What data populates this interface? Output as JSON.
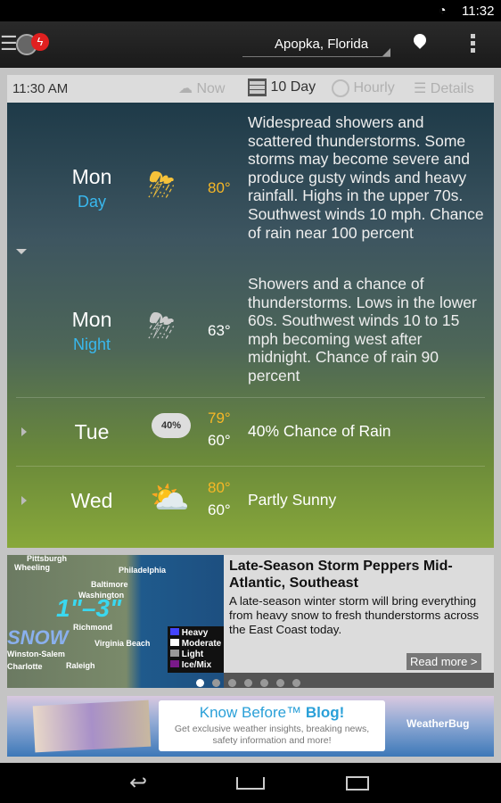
{
  "status": {
    "time": "11:32"
  },
  "actionbar": {
    "location": "Apopka, Florida"
  },
  "tabs": {
    "time": "11:30 AM",
    "now": "Now",
    "ten_day": "10 Day",
    "hourly": "Hourly",
    "details": "Details"
  },
  "forecast": [
    {
      "day": "Mon",
      "period": "Day",
      "temp": "80°",
      "icon": "sun-thunderstorm-icon",
      "desc": "Widespread showers and scattered thunderstorms. Some storms may become severe and produce gusty winds and heavy rainfall. Highs in the upper 70s. Southwest winds 10 mph. Chance of rain near 100 percent"
    },
    {
      "day": "Mon",
      "period": "Night",
      "temp": "63°",
      "icon": "thunderstorm-icon",
      "desc": "Showers and a chance of thunderstorms. Lows in the lower 60s. Southwest winds 10 to 15 mph becoming west after midnight. Chance of rain 90 percent"
    },
    {
      "day": "Tue",
      "high": "79°",
      "low": "60°",
      "icon": "rain-40-icon",
      "badge": "40%",
      "desc": "40% Chance of Rain"
    },
    {
      "day": "Wed",
      "high": "80°",
      "low": "60°",
      "icon": "partly-sunny-icon",
      "desc": "Partly Sunny"
    }
  ],
  "news": {
    "title": "Late-Season Storm Peppers Mid-Atlantic, Southeast",
    "body": "A late-season winter storm will bring everything from heavy snow to fresh thunderstorms across the East Coast today.",
    "read_more": "Read more >",
    "map_label": "1\"–3\"",
    "map_snow": "SNOW",
    "cities": [
      "Pittsburgh",
      "Wheeling",
      "Philadelphia",
      "Baltimore",
      "Washington",
      "Richmond",
      "Virginia Beach",
      "Winston-Salem",
      "Raleigh",
      "Charlotte"
    ],
    "legend": [
      "Heavy",
      "Moderate",
      "Light",
      "Ice/Mix"
    ],
    "page_dots": 7,
    "active_dot": 0
  },
  "ad": {
    "title_a": "Know Before™",
    "title_b": "Blog!",
    "text": "Get exclusive weather insights, breaking news, safety information and more!",
    "brand": "WeatherBug"
  },
  "colors": {
    "accent": "#39b8ee",
    "high": "#f6b726"
  }
}
